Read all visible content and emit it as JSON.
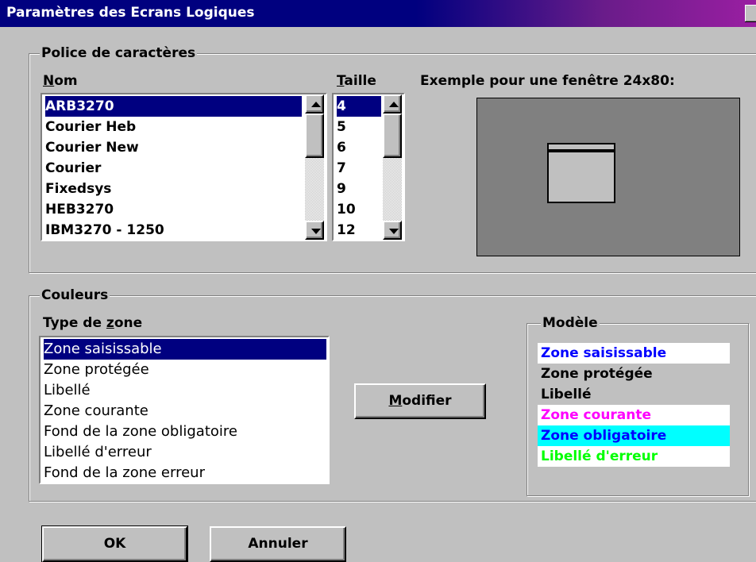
{
  "window": {
    "title": "Paramètres des Ecrans Logiques"
  },
  "font_group": {
    "legend": "Police de caractères",
    "name_label_u": "N",
    "name_label_rest": "om",
    "size_label_u": "T",
    "size_label_rest": "aille",
    "fonts": [
      "ARB3270",
      "Courier Heb",
      "Courier New",
      "Courier",
      "Fixedsys",
      "HEB3270",
      "IBM3270 - 1250"
    ],
    "selected_font": "ARB3270",
    "sizes": [
      "4",
      "5",
      "6",
      "7",
      "9",
      "10",
      "12"
    ],
    "selected_size": "4",
    "preview_label": "Exemple pour une fenêtre 24x80:"
  },
  "color_group": {
    "legend": "Couleurs",
    "zone_type_label_pre": "Type de ",
    "zone_type_label_u": "z",
    "zone_type_label_post": "one",
    "zones": [
      "Zone saisissable",
      "Zone protégée",
      "Libellé",
      "Zone courante",
      "Fond de la zone obligatoire",
      "Libellé d'erreur",
      "Fond de la zone erreur"
    ],
    "selected_zone": "Zone saisissable",
    "modify_u": "M",
    "modify_rest": "odifier",
    "model": {
      "legend": "Modèle",
      "rows": [
        {
          "label": "Zone saisissable",
          "fg": "#0000ff",
          "bg": "#ffffff"
        },
        {
          "label": "Zone protégée",
          "fg": "#000000",
          "bg": "#c0c0c0"
        },
        {
          "label": "Libellé",
          "fg": "#000000",
          "bg": "#c0c0c0"
        },
        {
          "label": "Zone courante",
          "fg": "#ff00ff",
          "bg": "#ffffff"
        },
        {
          "label": "Zone obligatoire",
          "fg": "#0000ff",
          "bg": "#00ffff"
        },
        {
          "label": "Libellé d'erreur",
          "fg": "#00ff00",
          "bg": "#ffffff"
        }
      ]
    }
  },
  "buttons": {
    "ok": "OK",
    "cancel": "Annuler"
  },
  "colors": {
    "title_start": "#00007f",
    "title_end": "#9a1fa2",
    "selection": "#000080",
    "dialog_bg": "#c0c0c0",
    "preview_bg": "#808080"
  }
}
